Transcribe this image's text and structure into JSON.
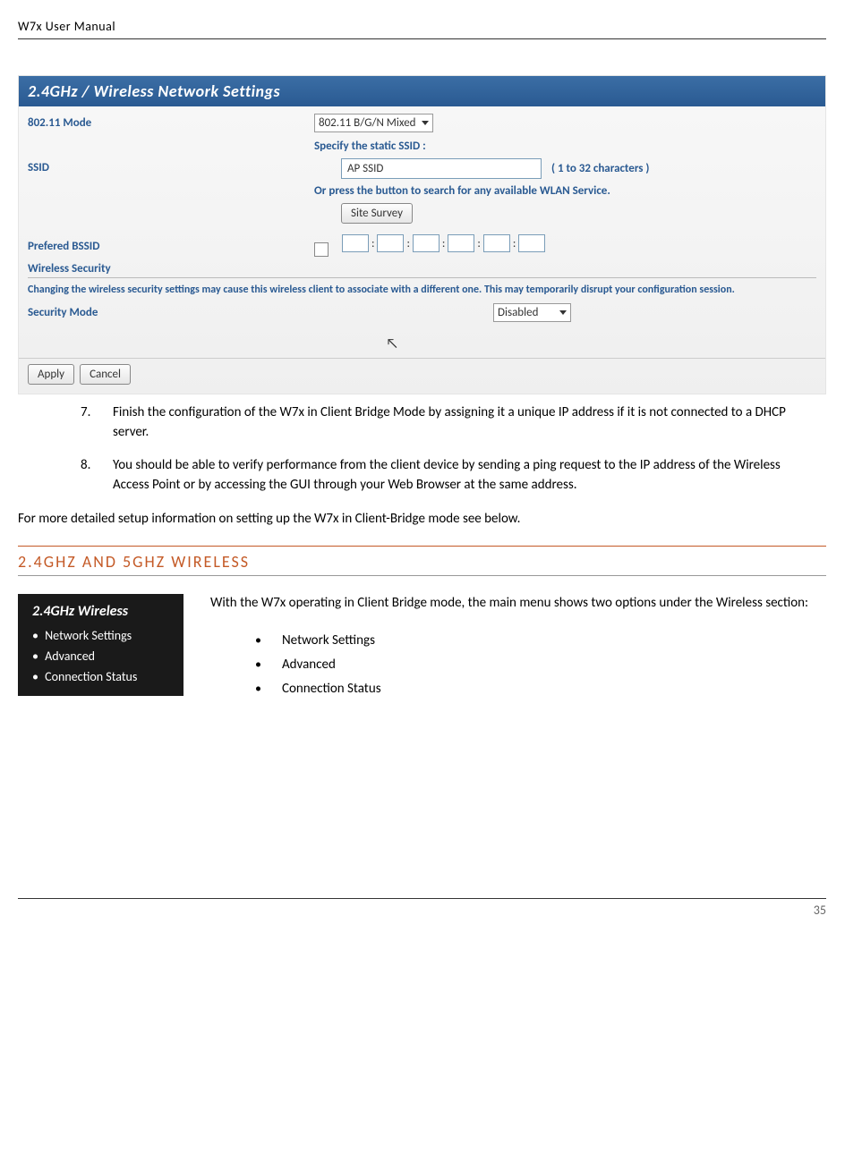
{
  "header": {
    "title": "W7x  User Manual"
  },
  "panel": {
    "title": "2.4GHz / Wireless Network Settings",
    "mode_label": "802.11 Mode",
    "mode_value": "802.11 B/G/N Mixed",
    "ssid_label": "SSID",
    "specify_text": "Specify the static SSID  :",
    "ssid_value": "AP SSID",
    "char_hint": "( 1 to 32 characters )",
    "or_press_text": "Or press the button to search for any available WLAN Service.",
    "site_survey_btn": "Site Survey",
    "bssid_label": "Prefered BSSID",
    "wireless_security_heading": "Wireless Security",
    "warning_text": "Changing the wireless security settings may cause this wireless client to associate with a different one. This may temporarily disrupt your configuration session.",
    "security_mode_label": "Security Mode",
    "security_mode_value": "Disabled",
    "apply_btn": "Apply",
    "cancel_btn": "Cancel"
  },
  "steps": {
    "step7_num": "7.",
    "step7_text": "Finish the configuration of the W7x in Client Bridge Mode by assigning it a unique IP address if it is not connected to a DHCP server.",
    "step8_num": "8.",
    "step8_text": "You should be able to verify performance from the client device by sending a ping request to the IP address of the Wireless Access Point or by accessing the GUI through your Web Browser at the same address."
  },
  "para_more": "For more detailed setup information on setting up the W7x in Client-Bridge mode see below.",
  "section_heading": "2.4GHZ AND 5GHZ WIRELESS",
  "menu": {
    "title": "2.4GHz Wireless",
    "items": [
      "Network Settings",
      "Advanced",
      "Connection Status"
    ]
  },
  "right_para": "With the W7x operating in Client Bridge mode, the main menu shows two options under the Wireless section:",
  "bullets": [
    "Network Settings",
    "Advanced",
    "Connection Status"
  ],
  "footer": {
    "page": "35"
  }
}
